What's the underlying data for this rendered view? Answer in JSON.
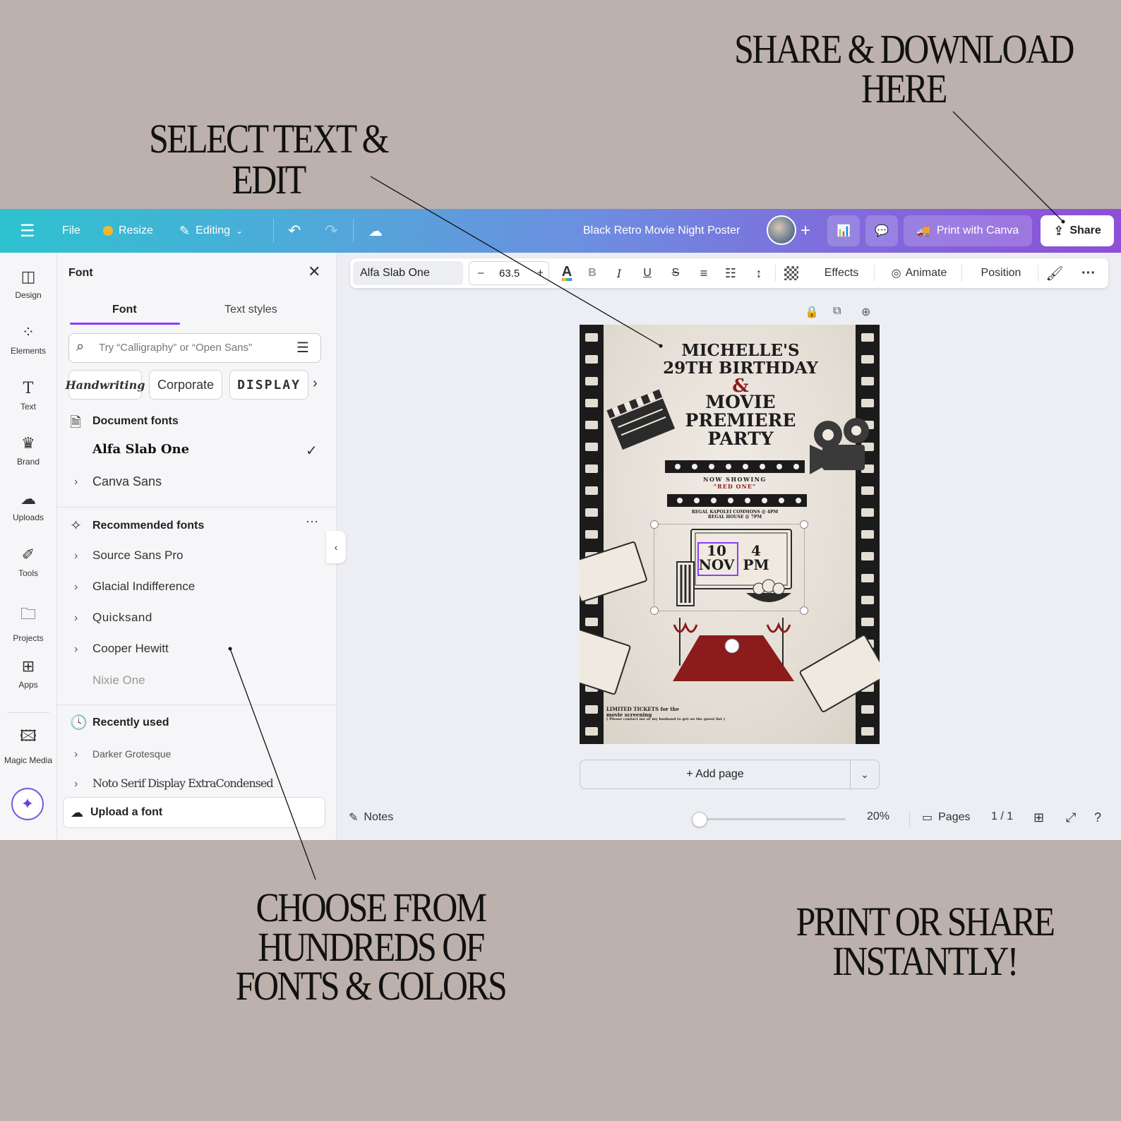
{
  "callouts": {
    "select": "SELECT TEXT & EDIT",
    "share_line1": "SHARE & DOWNLOAD",
    "share_line2": "HERE",
    "fonts_line1": "CHOOSE FROM",
    "fonts_line2": "HUNDREDS OF",
    "fonts_line3": "FONTS & COLORS",
    "print_line1": "PRINT OR SHARE",
    "print_line2": "INSTANTLY!"
  },
  "topbar": {
    "file": "File",
    "resize": "Resize",
    "editing": "Editing",
    "doc_title": "Black Retro Movie Night Poster",
    "print": "Print with Canva",
    "share": "Share"
  },
  "rail": {
    "design": "Design",
    "elements": "Elements",
    "text": "Text",
    "brand": "Brand",
    "uploads": "Uploads",
    "tools": "Tools",
    "projects": "Projects",
    "apps": "Apps",
    "magic_media": "Magic Media"
  },
  "panel": {
    "title": "Font",
    "tab_font": "Font",
    "tab_text_styles": "Text styles",
    "search_placeholder": "Try “Calligraphy” or “Open Sans”",
    "chips": [
      "Handwriting",
      "Corporate",
      "DISPLAY"
    ],
    "document_fonts": "Document fonts",
    "doc_font_items": [
      "Alfa Slab One",
      "Canva Sans"
    ],
    "recommended_fonts": "Recommended fonts",
    "recommended_items": [
      "Source Sans Pro",
      "Glacial Indifference",
      "Quicksand",
      "Cooper Hewitt",
      "Nixie One"
    ],
    "recently_used": "Recently used",
    "recent_items": [
      "Darker Grotesque",
      "Noto Serif Display ExtraCondensed"
    ],
    "upload_font": "Upload a font"
  },
  "toolbar": {
    "font": "Alfa Slab One",
    "size_minus": "–",
    "size": "63.5",
    "size_plus": "+",
    "effects": "Effects",
    "animate": "Animate",
    "position": "Position"
  },
  "poster": {
    "line1": "MICHELLE'S",
    "line2": "29TH BIRTHDAY",
    "amp": "&",
    "line3": "MOVIE",
    "line4": "PREMIERE",
    "line5": "PARTY",
    "now_showing": "NOW SHOWING",
    "red_one": "\"RED ONE\"",
    "venue1": "REGAL KAPOLEI COMMONS @ 4PM",
    "venue2": "REGAL HOUSE @ 7PM",
    "day": "10",
    "month": "NOV",
    "hour": "4",
    "ampm": "PM",
    "footer1": "LIMITED TICKETS for the",
    "footer2": "movie screening",
    "footer3": "( Please contact me or my husband to get on the guest list )"
  },
  "canvas": {
    "add_page": "+ Add page"
  },
  "bottombar": {
    "notes": "Notes",
    "zoom": "20%",
    "pages": "Pages",
    "page_count": "1 / 1"
  },
  "colors": {
    "background": "#bcb1ac",
    "accent_purple": "#8b3dff",
    "gradient_start": "#2ec2d0",
    "gradient_end": "#8d4fd6",
    "carpet_red": "#8c1b1b"
  }
}
